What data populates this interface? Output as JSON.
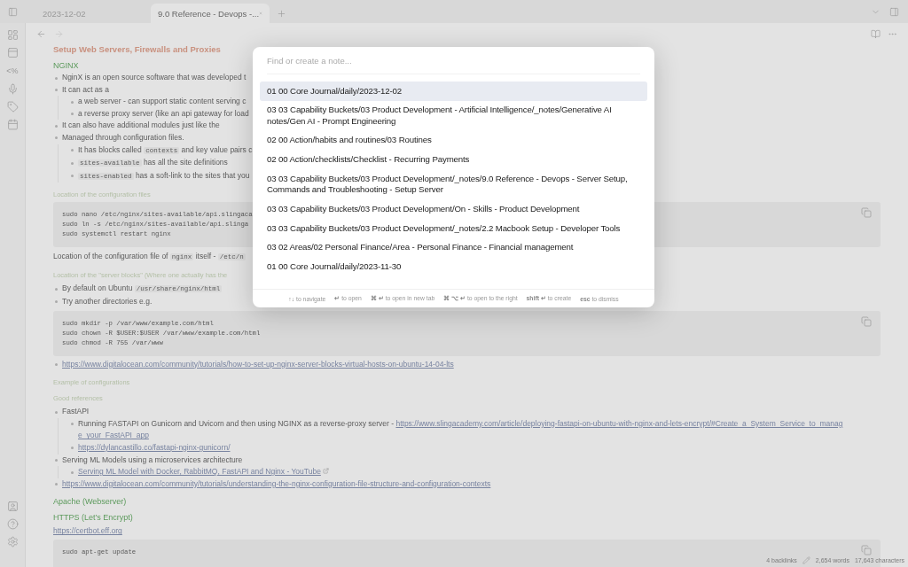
{
  "tabs": [
    {
      "label": "2023-12-02",
      "selected": false
    },
    {
      "label": "9.0 Reference - Devops -...",
      "selected": true
    }
  ],
  "ribbon_glyph": "<%",
  "document": [
    {
      "kind": "title",
      "text": "Setup Web Servers, Firewalls and Proxies"
    },
    {
      "kind": "heading",
      "text": "NGINX"
    },
    {
      "kind": "list",
      "items": [
        {
          "parts": [
            {
              "kind": "text",
              "text": "NginX is an open source software that was developed t"
            }
          ]
        },
        {
          "parts": [
            {
              "kind": "text",
              "text": "It can act as a"
            }
          ],
          "children": [
            {
              "parts": [
                {
                  "kind": "text",
                  "text": "a web server - can support static content serving c"
                }
              ]
            },
            {
              "parts": [
                {
                  "kind": "text",
                  "text": "a reverse proxy server (like an api gateway for load"
                }
              ]
            }
          ]
        },
        {
          "parts": [
            {
              "kind": "text",
              "text": "It can also have additional modules just like the"
            }
          ]
        },
        {
          "parts": [
            {
              "kind": "text",
              "text": "Managed through configuration files."
            }
          ],
          "children": [
            {
              "parts": [
                {
                  "kind": "text",
                  "text": "It has blocks called "
                },
                {
                  "kind": "code",
                  "text": "contexts"
                },
                {
                  "kind": "text",
                  "text": " and key value pairs c"
                }
              ]
            },
            {
              "parts": [
                {
                  "kind": "code",
                  "text": "sites-available"
                },
                {
                  "kind": "text",
                  "text": " has all the site definitions"
                }
              ]
            },
            {
              "parts": [
                {
                  "kind": "code",
                  "text": "sites-enabled"
                },
                {
                  "kind": "text",
                  "text": " has a soft-link to the sites that you"
                }
              ]
            }
          ]
        }
      ]
    },
    {
      "kind": "caption",
      "text": "Location of the configuration files"
    },
    {
      "kind": "code",
      "lines": [
        "sudo nano /etc/nginx/sites-available/api.slingaca",
        "sudo ln -s /etc/nginx/sites-available/api.slinga",
        "sudo systemctl restart nginx"
      ]
    },
    {
      "kind": "para",
      "parts": [
        {
          "kind": "text",
          "text": "Location of the configuration file of "
        },
        {
          "kind": "code",
          "text": "nginx"
        },
        {
          "kind": "text",
          "text": " itself - "
        },
        {
          "kind": "code",
          "text": "/etc/n"
        }
      ]
    },
    {
      "kind": "caption",
      "text": "Location of the \"server blocks\" (Where one actually has the"
    },
    {
      "kind": "list",
      "items": [
        {
          "parts": [
            {
              "kind": "text",
              "text": "By default on Ubuntu "
            },
            {
              "kind": "code",
              "text": "/usr/share/nginx/html"
            }
          ]
        },
        {
          "parts": [
            {
              "kind": "text",
              "text": "Try another directories e.g."
            }
          ]
        }
      ]
    },
    {
      "kind": "code",
      "lines": [
        "sudo mkdir -p /var/www/example.com/html",
        "sudo chown -R $USER:$USER /var/www/example.com/html",
        "sudo chmod -R 755 /var/www"
      ]
    },
    {
      "kind": "list",
      "items": [
        {
          "parts": [
            {
              "kind": "link",
              "text": "https://www.digitalocean.com/community/tutorials/how-to-set-up-nginx-server-blocks-virtual-hosts-on-ubuntu-14-04-lts"
            }
          ]
        }
      ]
    },
    {
      "kind": "caption",
      "text": "Example of configurations"
    },
    {
      "kind": "caption",
      "text": "Good references"
    },
    {
      "kind": "list",
      "items": [
        {
          "parts": [
            {
              "kind": "text",
              "text": "FastAPI"
            }
          ],
          "children": [
            {
              "parts": [
                {
                  "kind": "text",
                  "text": "Running FASTAPI on Gunicorn and Uvicorn and then using NGINX as a reverse-proxy server - "
                },
                {
                  "kind": "link",
                  "text": "https://www.slingacademy.com/article/deploying-fastapi-on-ubuntu-with-nginx-and-lets-encrypt/#Create_a_System_Service_to_manag"
                },
                {
                  "kind": "link",
                  "text": "e_your_FastAPI_app"
                }
              ]
            },
            {
              "parts": [
                {
                  "kind": "link",
                  "text": "https://dylancastillo.co/fastapi-nginx-gunicorn/"
                }
              ]
            }
          ]
        },
        {
          "parts": [
            {
              "kind": "text",
              "text": "Serving ML Models using a microservices architecture"
            }
          ],
          "children": [
            {
              "parts": [
                {
                  "kind": "link",
                  "text": "Serving ML Model with Docker, RabbitMQ, FastAPI and Nginx - YouTube",
                  "external": true
                }
              ]
            }
          ]
        },
        {
          "parts": [
            {
              "kind": "link",
              "text": "https://www.digitalocean.com/community/tutorials/understanding-the-nginx-configuration-file-structure-and-configuration-contexts"
            }
          ]
        }
      ]
    },
    {
      "kind": "heading",
      "text": "Apache (Webserver)"
    },
    {
      "kind": "heading",
      "text": "HTTPS (Let’s Encrypt)"
    },
    {
      "kind": "para",
      "parts": [
        {
          "kind": "link",
          "text": "https://certbot.eff.org"
        }
      ]
    },
    {
      "kind": "code",
      "lines": [
        "sudo apt-get update"
      ]
    }
  ],
  "switcher": {
    "placeholder": "Find or create a note...",
    "results": [
      {
        "text": "01 00 Core Journal/daily/2023-12-02",
        "selected": true
      },
      {
        "text": "03 03 Capability Buckets/03 Product Development - Artificial Intelligence/_notes/Generative AI notes/Gen AI - Prompt Engineering",
        "selected": false
      },
      {
        "text": "02 00 Action/habits and routines/03 Routines",
        "selected": false
      },
      {
        "text": "02 00 Action/checklists/Checklist - Recurring Payments",
        "selected": false
      },
      {
        "text": "03 03 Capability Buckets/03 Product Development/_notes/9.0  Reference - Devops - Server Setup, Commands and Troubleshooting - Setup Server",
        "selected": false
      },
      {
        "text": "03 03 Capability Buckets/03 Product Development/On - Skills - Product Development",
        "selected": false
      },
      {
        "text": "03 03 Capability Buckets/03 Product Development/_notes/2.2 Macbook Setup - Developer Tools",
        "selected": false
      },
      {
        "text": "03 02 Areas/02 Personal Finance/Area - Personal Finance - Financial management",
        "selected": false
      },
      {
        "text": "01 00 Core Journal/daily/2023-11-30",
        "selected": false
      }
    ],
    "hints": [
      {
        "keys": "↑↓",
        "text": "to navigate"
      },
      {
        "keys": "↵",
        "text": "to open"
      },
      {
        "keys": "⌘ ↵",
        "text": "to open in new tab"
      },
      {
        "keys": "⌘ ⌥ ↵",
        "text": "to open to the right"
      },
      {
        "keys": "shift ↵",
        "text": "to create"
      },
      {
        "keys": "esc",
        "text": "to dismiss"
      }
    ]
  },
  "status_bar": {
    "backlinks": "4 backlinks",
    "words": "2,654 words",
    "characters": "17,643 characters"
  }
}
